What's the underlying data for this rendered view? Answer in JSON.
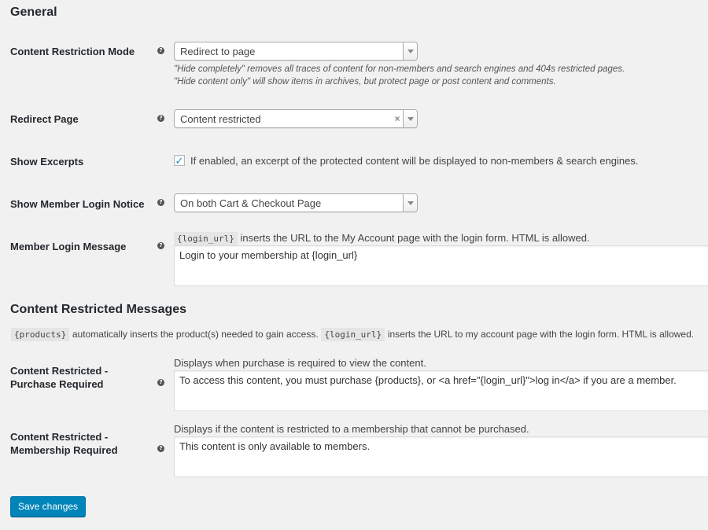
{
  "general": {
    "heading": "General",
    "restriction_mode": {
      "label": "Content Restriction Mode",
      "selected": "Redirect to page",
      "desc_line1": "\"Hide completely\" removes all traces of content for non-members and search engines and 404s restricted pages.",
      "desc_line2": "\"Hide content only\" will show items in archives, but protect page or post content and comments."
    },
    "redirect_page": {
      "label": "Redirect Page",
      "selected": "Content restricted",
      "clear_symbol": "×"
    },
    "show_excerpts": {
      "label": "Show Excerpts",
      "checked": true,
      "check_symbol": "✓",
      "description": "If enabled, an excerpt of the protected content will be displayed to non-members & search engines."
    },
    "login_notice": {
      "label": "Show Member Login Notice",
      "selected": "On both Cart & Checkout Page"
    },
    "login_message": {
      "label": "Member Login Message",
      "code": "{login_url}",
      "hint": "inserts the URL to the My Account page with the login form. HTML is allowed.",
      "value": "Login to your membership at {login_url}"
    }
  },
  "restricted": {
    "heading": "Content Restricted Messages",
    "info_code1": "{products}",
    "info_text1": "automatically inserts the product(s) needed to gain access.",
    "info_code2": "{login_url}",
    "info_text2": "inserts the URL to my account page with the login form. HTML is allowed.",
    "purchase": {
      "label_line1": "Content Restricted -",
      "label_line2": "Purchase Required",
      "hint": "Displays when purchase is required to view the content.",
      "value": "To access this content, you must purchase {products}, or <a href=\"{login_url}\">log in</a> if you are a member."
    },
    "membership": {
      "label_line1": "Content Restricted -",
      "label_line2": "Membership Required",
      "hint": "Displays if the content is restricted to a membership that cannot be purchased.",
      "value": "This content is only available to members."
    }
  },
  "help_icon_glyph": "?",
  "save_button": "Save changes",
  "colors": {
    "primary": "#0085ba",
    "background": "#f1f1f1",
    "checkmark": "#1e8cbe"
  }
}
